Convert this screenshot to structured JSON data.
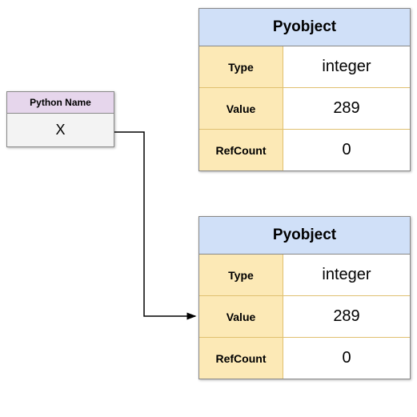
{
  "name_table": {
    "header": "Python Name",
    "value": "X"
  },
  "pyobject1": {
    "header": "Pyobject",
    "rows": {
      "type_label": "Type",
      "type_value": "integer",
      "value_label": "Value",
      "value_value": "289",
      "refcount_label": "RefCount",
      "refcount_value": "0"
    }
  },
  "pyobject2": {
    "header": "Pyobject",
    "rows": {
      "type_label": "Type",
      "type_value": "integer",
      "value_label": "Value",
      "value_value": "289",
      "refcount_label": "RefCount",
      "refcount_value": "0"
    }
  }
}
